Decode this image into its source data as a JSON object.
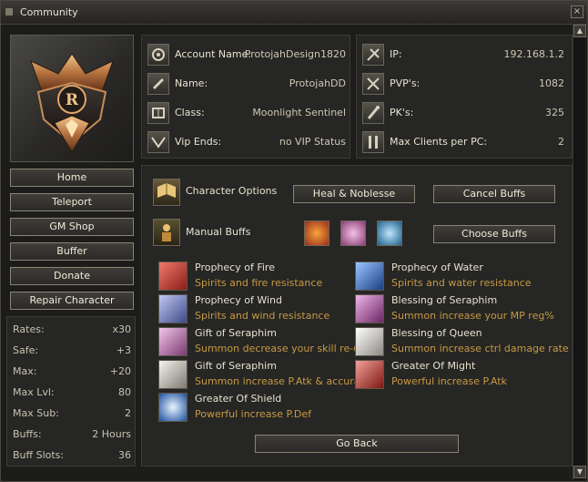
{
  "window": {
    "title": "Community",
    "close_glyph": "×"
  },
  "scroll": {
    "up_glyph": "▲",
    "down_glyph": "▼"
  },
  "menu": [
    "Home",
    "Teleport",
    "GM Shop",
    "Buffer",
    "Donate",
    "Repair Character"
  ],
  "stats": [
    {
      "label": "Rates:",
      "value": "x30"
    },
    {
      "label": "Safe:",
      "value": "+3"
    },
    {
      "label": "Max:",
      "value": "+20"
    },
    {
      "label": "Max Lvl:",
      "value": "80"
    },
    {
      "label": "Max Sub:",
      "value": "2"
    },
    {
      "label": "Buffs:",
      "value": "2 Hours"
    },
    {
      "label": "Buff Slots:",
      "value": "36"
    }
  ],
  "account_info": [
    {
      "label": "Account Name:",
      "value": "ProtojahDesign1820",
      "icon": "account-icon"
    },
    {
      "label": "Name:",
      "value": "ProtojahDD",
      "icon": "name-icon"
    },
    {
      "label": "Class:",
      "value": "Moonlight Sentinel",
      "icon": "class-icon"
    },
    {
      "label": "Vip Ends:",
      "value": "no VIP Status",
      "icon": "vip-icon"
    }
  ],
  "server_info": [
    {
      "label": "IP:",
      "value": "192.168.1.2",
      "icon": "ip-icon"
    },
    {
      "label": "PVP's:",
      "value": "1082",
      "icon": "pvp-icon"
    },
    {
      "label": "PK's:",
      "value": "325",
      "icon": "pk-icon"
    },
    {
      "label": "Max Clients per PC:",
      "value": "2",
      "icon": "clients-icon"
    }
  ],
  "options": {
    "character_options": "Character Options",
    "manual_buffs": "Manual Buffs",
    "heal_button": "Heal & Noblesse",
    "cancel_button": "Cancel Buffs",
    "choose_button": "Choose Buffs",
    "go_back": "Go Back"
  },
  "buffs": [
    {
      "name": "Prophecy of Fire",
      "desc": "Spirits and fire resistance",
      "color": "#c23a2e"
    },
    {
      "name": "Prophecy of Water",
      "desc": "Spirits and water resistance",
      "color": "#3a6fb8"
    },
    {
      "name": "Prophecy of Wind",
      "desc": "Spirits and wind resistance",
      "color": "#6f7fb8"
    },
    {
      "name": "Blessing of Seraphim",
      "desc": "Summon increase your MP reg%",
      "color": "#a24aa0"
    },
    {
      "name": "Gift of Seraphim",
      "desc": "Summon decrease your skill re-use",
      "color": "#b86aa6"
    },
    {
      "name": "Blessing of Queen",
      "desc": "Summon increase ctrl damage rate",
      "color": "#d9d6cf"
    },
    {
      "name": "Gift of Seraphim",
      "desc": "Summon increase P.Atk & accuracy",
      "color": "#cfcac0"
    },
    {
      "name": "Greater Of Might",
      "desc": "Powerful increase P.Atk",
      "color": "#b8312a"
    },
    {
      "name": "Greater Of Shield",
      "desc": "Powerful increase P.Def",
      "color": "#3a6ec4"
    }
  ]
}
